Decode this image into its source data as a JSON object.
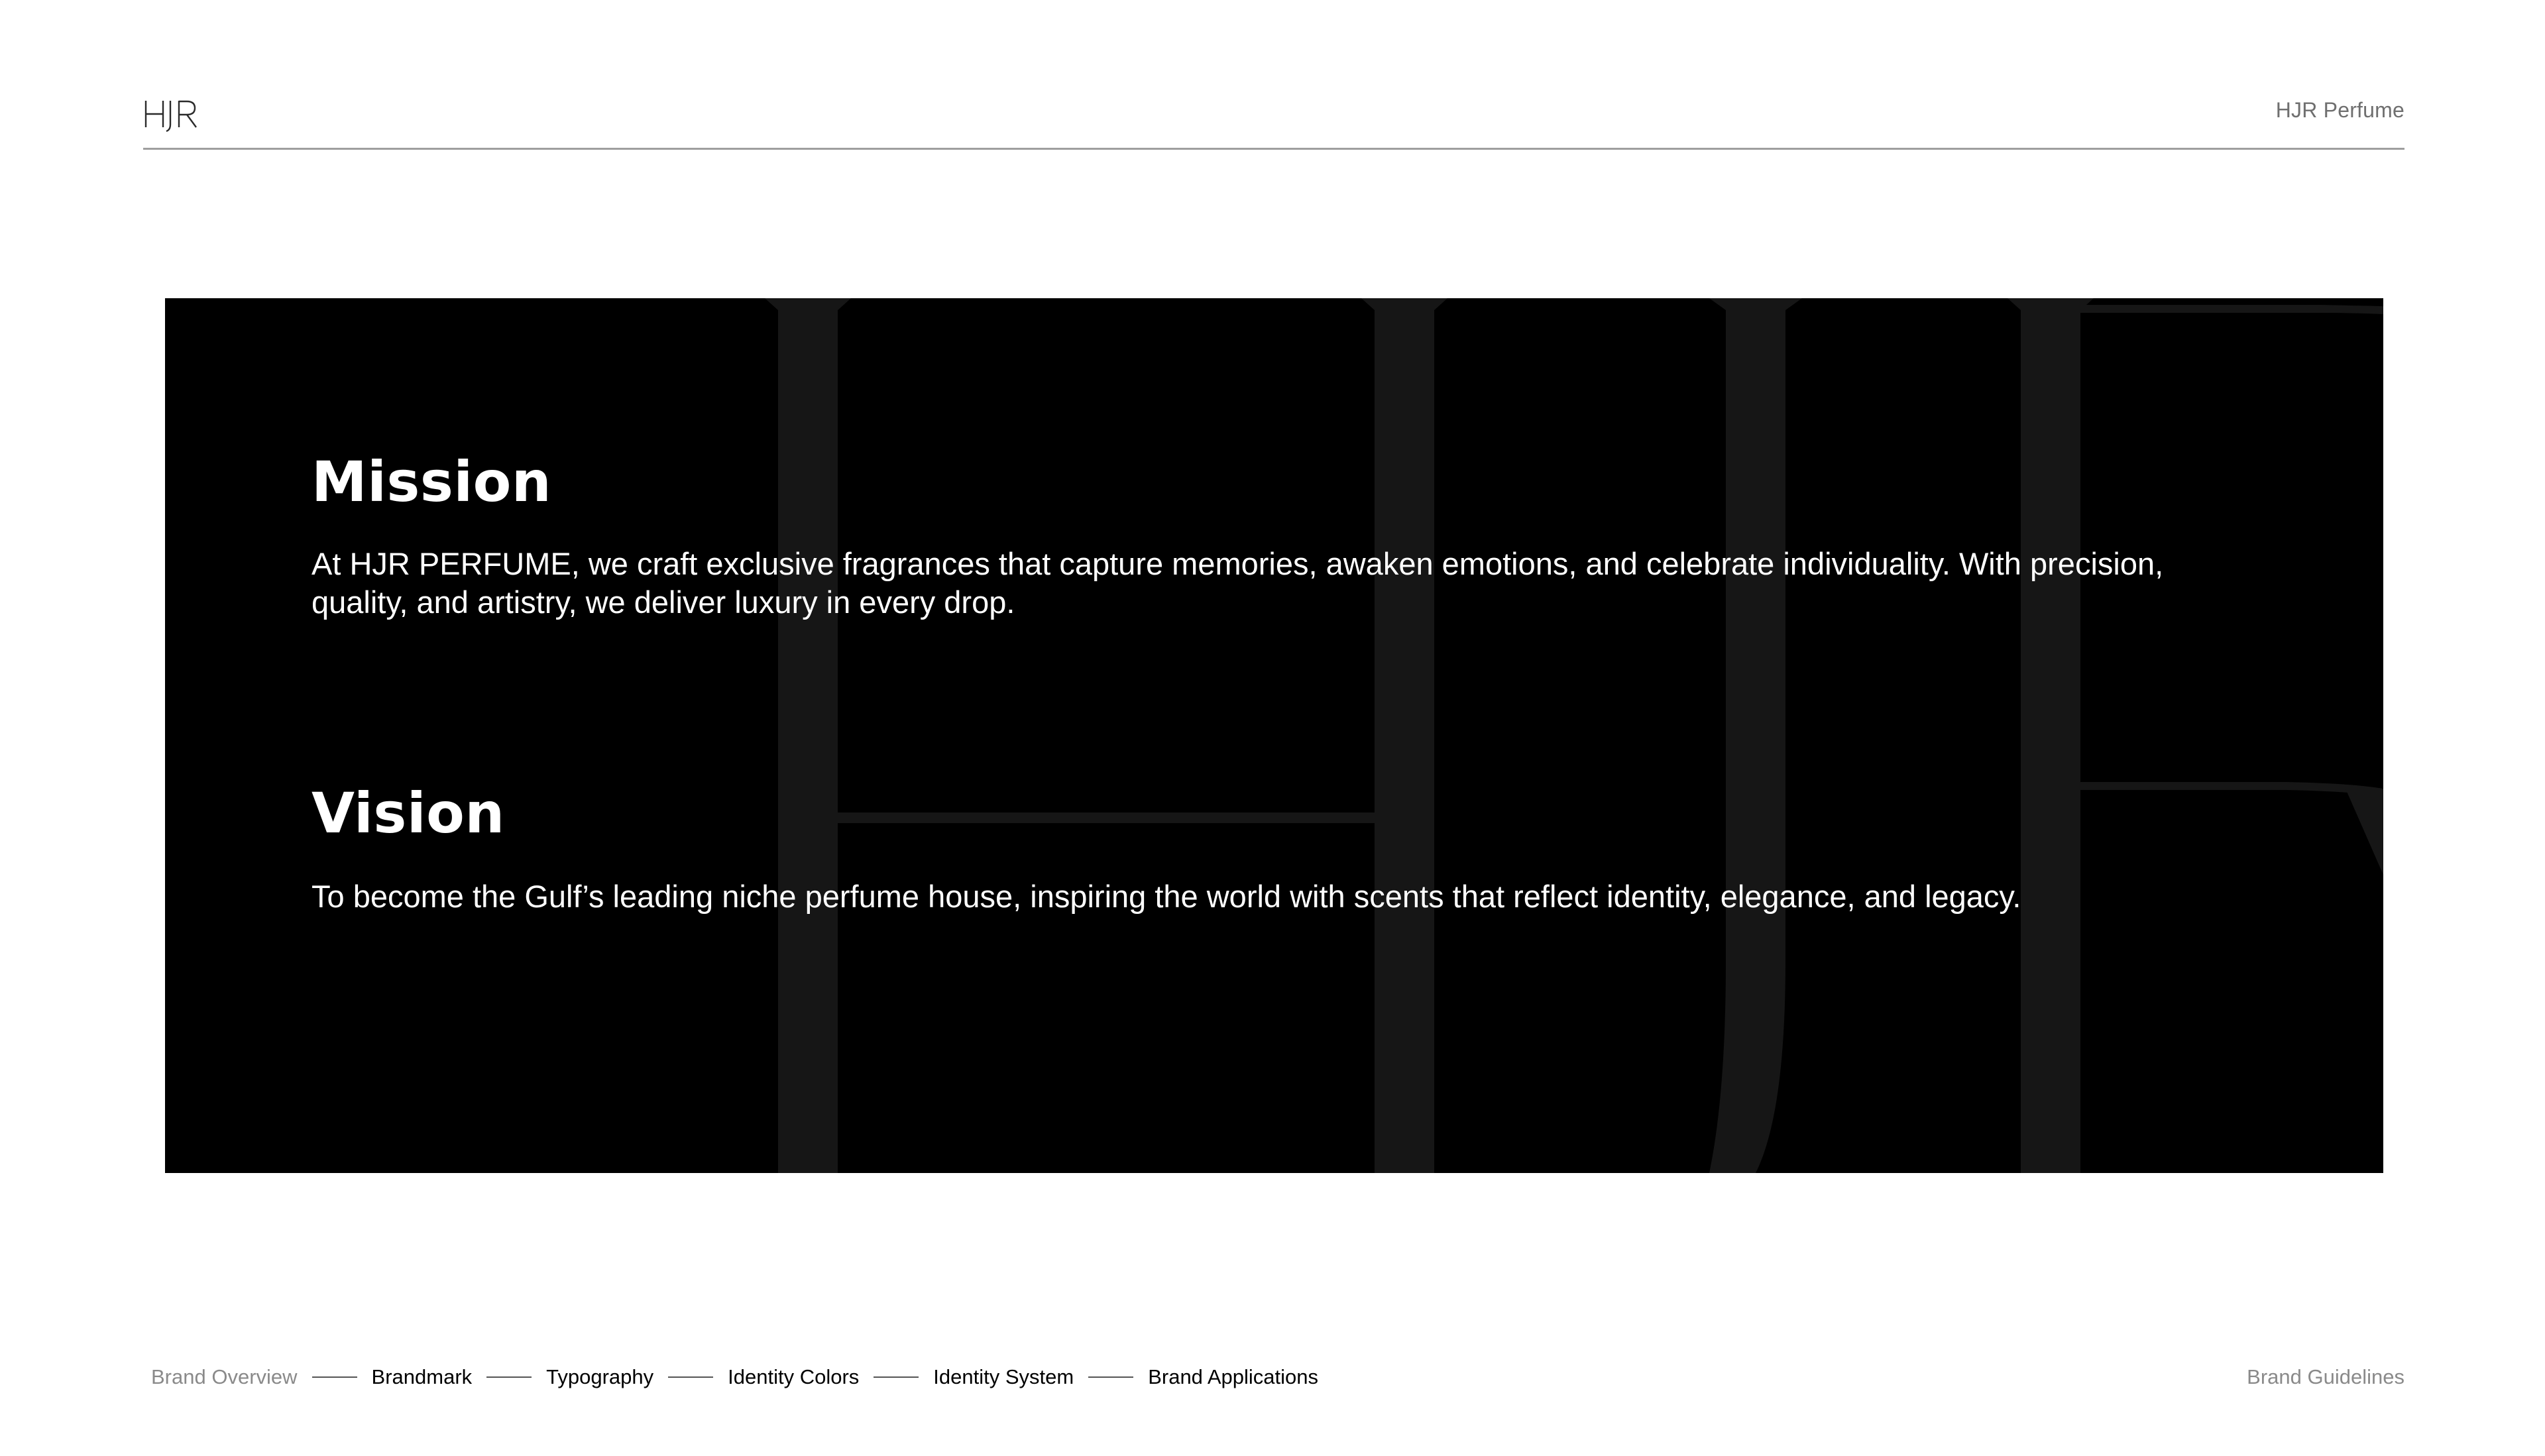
{
  "header": {
    "logo_text": "HJR",
    "brand_name": "HJR Perfume"
  },
  "panel": {
    "watermark_text": "HJR",
    "background_color": "#000000",
    "watermark_color": "#161616"
  },
  "mission": {
    "heading": "Mission",
    "text": "At HJR PERFUME, we craft exclusive fragrances that capture memories, awaken emotions, and celebrate individuality. With precision, quality, and artistry, we deliver luxury in every drop."
  },
  "vision": {
    "heading": "Vision",
    "text": "To become the Gulf’s leading niche perfume house, inspiring the world with scents that reflect identity, elegance, and legacy."
  },
  "footer": {
    "nav": [
      {
        "label": "Brand Overview",
        "active": false
      },
      {
        "label": "Brandmark",
        "active": true
      },
      {
        "label": "Typography",
        "active": true
      },
      {
        "label": "Identity Colors",
        "active": true
      },
      {
        "label": "Identity System",
        "active": true
      },
      {
        "label": "Brand Applications",
        "active": true
      }
    ],
    "right_label": "Brand Guidelines"
  }
}
